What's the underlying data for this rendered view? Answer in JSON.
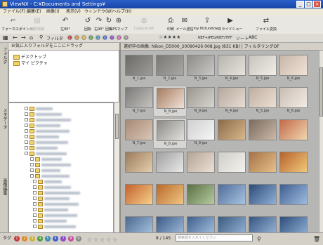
{
  "window": {
    "title": "ViewNX - C:¥Documents and Settings¥"
  },
  "menu": [
    "ファイル(F)",
    "編集(E)",
    "画像(I)",
    "表示(V)",
    "ウィンドウ(W)",
    "ヘルプ(H)"
  ],
  "toolbar": {
    "buttons": [
      {
        "label": "フォーカスポイント",
        "icon": "focus-point-icon",
        "glyph": "⌐",
        "disabled": false
      },
      {
        "label": "撮影情報",
        "icon": "shooting-info-icon",
        "glyph": "▤",
        "disabled": true
      },
      {
        "label": "左90°",
        "icon": "rotate-left-icon",
        "glyph": "↶",
        "disabled": false
      },
      {
        "label": "回転",
        "icon": "rotate-icon",
        "glyph": "↺",
        "disabled": false
      },
      {
        "label": "右90°",
        "icon": "rotate-right-icon",
        "glyph": "↷",
        "disabled": false
      },
      {
        "label": "回転",
        "icon": "rotate-icon",
        "glyph": "↻",
        "disabled": false
      },
      {
        "label": "GPSマップ",
        "icon": "gps-map-icon",
        "glyph": "⊕",
        "disabled": false
      },
      {
        "label": "Capture NX",
        "icon": "capture-nx-icon",
        "glyph": "◍",
        "disabled": true
      },
      {
        "label": "印刷",
        "icon": "print-icon",
        "glyph": "⎙",
        "disabled": false
      },
      {
        "label": "メール送信",
        "icon": "mail-icon",
        "glyph": "✉",
        "disabled": false
      },
      {
        "label": "my Picturetown",
        "icon": "upload-icon",
        "glyph": "⇪",
        "disabled": false
      },
      {
        "label": "スライドショー",
        "icon": "slideshow-icon",
        "glyph": "▶",
        "disabled": false
      },
      {
        "label": "ファイル変換",
        "icon": "convert-icon",
        "glyph": "⇄",
        "disabled": false
      }
    ]
  },
  "toolbar2": {
    "filter_label": "フィルタ",
    "rating_prefix": "☆★★★★",
    "format_label": "NEF+JPEG/NEF/TIFF",
    "sort_label": "ソート",
    "sort_key": "ABC",
    "label_dots": [
      "1",
      "2",
      "3",
      "4",
      "5",
      "6",
      "7",
      "8",
      "9"
    ]
  },
  "left": {
    "favorites_header": "お気に入りフォルダをここにドラッグ",
    "favorites": [
      "デスクトップ",
      "マイ ピクチャ"
    ],
    "sidetabs": [
      "フォルダ",
      "メタデータ",
      "画像編集"
    ]
  },
  "info": {
    "text": "選択中の画像: Nikon_D5000_20090426 008.jpg (831 KB) | フィルタリングOF"
  },
  "thumbs": [
    {
      "name": "N_1.jpe",
      "selected": false,
      "colors": [
        "#6b6a66",
        "#9e9c98"
      ]
    },
    {
      "name": "N_2.jpe",
      "selected": false,
      "colors": [
        "#7a7875",
        "#aaa8a4"
      ]
    },
    {
      "name": "N_3.jpe",
      "selected": false,
      "colors": [
        "#8d8b87",
        "#cbc9c6"
      ]
    },
    {
      "name": "N_4.jpe",
      "selected": false,
      "colors": [
        "#b8b5ae",
        "#e6e3dd"
      ]
    },
    {
      "name": "N_5.jpe",
      "selected": false,
      "colors": [
        "#c7c4bd",
        "#f1eee7"
      ]
    },
    {
      "name": "N_6.jpe",
      "selected": false,
      "colors": [
        "#c8b7a9",
        "#f0e2d6"
      ]
    },
    {
      "name": "N_7.jpe",
      "selected": false,
      "colors": [
        "#7c7a78",
        "#c5c3c0"
      ]
    },
    {
      "name": "N_8.jpe",
      "selected": true,
      "colors": [
        "#a77c60",
        "#f0e2d8"
      ]
    },
    {
      "name": "N_9.jpe",
      "selected": false,
      "colors": [
        "#9a9690",
        "#d8d4ce"
      ]
    },
    {
      "name": "N_4.jpe",
      "selected": false,
      "colors": [
        "#b5a79a",
        "#e8ded6"
      ]
    },
    {
      "name": "N_5.jpe",
      "selected": false,
      "colors": [
        "#bfae9e",
        "#ebe0d6"
      ]
    },
    {
      "name": "N_6.jpe",
      "selected": false,
      "colors": [
        "#c9bdb2",
        "#f3ece6"
      ]
    },
    {
      "name": "N_7.jpe",
      "selected": false,
      "colors": [
        "#a88a74",
        "#d9c6b8"
      ]
    },
    {
      "name": "N_8.jpe",
      "selected": true,
      "colors": [
        "#8c8a86",
        "#e3e1dd"
      ]
    },
    {
      "name": "N_9.jpe",
      "selected": false,
      "colors": [
        "#cfcfcf",
        "#f6f6f6"
      ]
    },
    {
      "name": "",
      "selected": false,
      "colors": [
        "#8b6a4a",
        "#d8b88c"
      ]
    },
    {
      "name": "",
      "selected": false,
      "colors": [
        "#7a6b5e",
        "#cbb9a8"
      ]
    },
    {
      "name": "",
      "selected": false,
      "colors": [
        "#c26b4a",
        "#f0d6b0"
      ]
    },
    {
      "name": "",
      "selected": false,
      "colors": [
        "#9a7b5c",
        "#e6cfae"
      ]
    },
    {
      "name": "",
      "selected": false,
      "colors": [
        "#a0a0a0",
        "#e8e8e8"
      ]
    },
    {
      "name": "",
      "selected": false,
      "colors": [
        "#b4a496",
        "#ece0d4"
      ]
    },
    {
      "name": "",
      "selected": false,
      "colors": [
        "#cfcdc8",
        "#f4f2ee"
      ]
    },
    {
      "name": "",
      "selected": false,
      "colors": [
        "#a57246",
        "#e6c08a"
      ]
    },
    {
      "name": "",
      "selected": false,
      "colors": [
        "#b5632e",
        "#f2c87a"
      ]
    },
    {
      "name": "",
      "selected": false,
      "colors": [
        "#c4622c",
        "#f6d08a"
      ]
    },
    {
      "name": "",
      "selected": false,
      "colors": [
        "#b8692a",
        "#f0c684"
      ]
    },
    {
      "name": "",
      "selected": false,
      "colors": [
        "#5a7044",
        "#b6cca0"
      ]
    },
    {
      "name": "",
      "selected": false,
      "colors": [
        "#4f6d9a",
        "#a8c2e0"
      ]
    },
    {
      "name": "",
      "selected": false,
      "colors": [
        "#2e4a78",
        "#8fb0d6"
      ]
    },
    {
      "name": "",
      "selected": false,
      "colors": [
        "#3e5e8e",
        "#9fbce0"
      ]
    },
    {
      "name": "",
      "selected": false,
      "colors": [
        "#4a6a90",
        "#aec6e2"
      ]
    },
    {
      "name": "",
      "selected": false,
      "colors": [
        "#3c5a86",
        "#a2bede"
      ]
    },
    {
      "name": "",
      "selected": false,
      "colors": [
        "#40608c",
        "#a8c4e4"
      ]
    },
    {
      "name": "",
      "selected": false,
      "colors": [
        "#3a5a80",
        "#98b6d8"
      ]
    },
    {
      "name": "",
      "selected": false,
      "colors": [
        "#365682",
        "#9cb8da"
      ]
    },
    {
      "name": "",
      "selected": false,
      "colors": [
        "#2e4e7c",
        "#94b2d6"
      ]
    },
    {
      "name": "",
      "selected": false,
      "colors": [
        "#5a7aa6",
        "#b8cfea"
      ]
    },
    {
      "name": "",
      "selected": false,
      "colors": [
        "#4e6e9e",
        "#b0c8e6"
      ]
    },
    {
      "name": "",
      "selected": false,
      "colors": [
        "#3d6a8a",
        "#a0c4da"
      ]
    },
    {
      "name": "",
      "selected": false,
      "colors": [
        "#4c7c90",
        "#aed0dc"
      ]
    },
    {
      "name": "",
      "selected": false,
      "colors": [
        "#3a6078",
        "#98bccf"
      ]
    },
    {
      "name": "",
      "selected": false,
      "colors": [
        "#5a7e98",
        "#b4d0e0"
      ]
    }
  ],
  "status": {
    "tag_label": "タグ",
    "tag_dots": [
      "1",
      "2",
      "3",
      "4",
      "5",
      "6",
      "7",
      "8",
      "9"
    ],
    "stars": [
      "☆",
      "☆",
      "☆",
      "☆",
      "☆"
    ],
    "page": "8 / 145",
    "search_placeholder": "検索語を入れてください",
    "colors": [
      "#c23b3b",
      "#d98b2b",
      "#c9b33a",
      "#4d9b3b",
      "#3b8bb3",
      "#3b5bc9",
      "#8a4bc9",
      "#c94b9b",
      "#888888"
    ]
  }
}
